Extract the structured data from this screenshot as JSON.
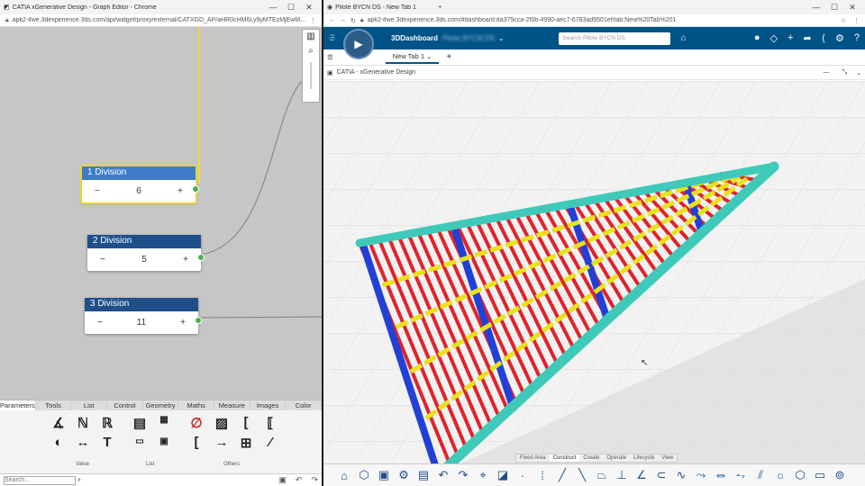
{
  "left_window": {
    "title": "CATIA xGenerative Design - Graph Editor - Chrome",
    "url": "apk2-ifwe.3dexperience.3ds.com/api/widget/proxy/external/CATXGD_AP/aHR0cHM6Ly9yMTEzMjEwM...",
    "nodes": [
      {
        "label": "1 Division",
        "value": "6",
        "minus": "−",
        "plus": "+"
      },
      {
        "label": "2 Division",
        "value": "5",
        "minus": "−",
        "plus": "+"
      },
      {
        "label": "3 Division",
        "value": "11",
        "minus": "−",
        "plus": "+"
      }
    ],
    "palette_tabs": [
      "Parameters",
      "Tools",
      "List",
      "Control",
      "Geometry",
      "Maths",
      "Measure",
      "Images",
      "Color"
    ],
    "palette_groups": [
      "Value",
      "List",
      "Others"
    ],
    "palette_icons": [
      "angle-icon",
      "N-icon",
      "R-icon",
      "half-circle-icon",
      "dimension-icon",
      "text-T-icon",
      "table-icon",
      "number-list-icon",
      "list-icon",
      "range-list-icon",
      "empty-set-icon",
      "image-icon",
      "bracket-icon",
      "brackets-icon",
      "bracket-one-icon",
      "arrow-to-point-icon",
      "book-icon",
      "line-icon"
    ],
    "search_placeholder": "Search..."
  },
  "right_window": {
    "title": "Pilote BYCN DS - New Tab 1",
    "url": "apk2-ifwe.3dexperience.3ds.com/#dashboard:da375cca-2f0b-4990-aec7-6783ad9501ef/tab:New%20Tab%201",
    "dashboard_label": "3DDashboard",
    "dashboard_name": "Pilote BYCN DS",
    "search_placeholder": "Search Pilote BYCN DS",
    "tab_label": "New Tab 1",
    "app_title": "CATIA - xGenerative Design",
    "bottom_tabs": [
      "Fixed Area",
      "Construct",
      "Create",
      "Operate",
      "Lifecycle",
      "View"
    ],
    "active_bottom_tab": "Construct"
  },
  "colors": {
    "node_header": "#1f4f8b",
    "port": "#4caf50",
    "dash_bar": "#005386",
    "rail": "#3fc9b8",
    "rod_red": "#e0232b",
    "beam_blue": "#2340d6",
    "cross_yellow": "#e8e21c"
  }
}
